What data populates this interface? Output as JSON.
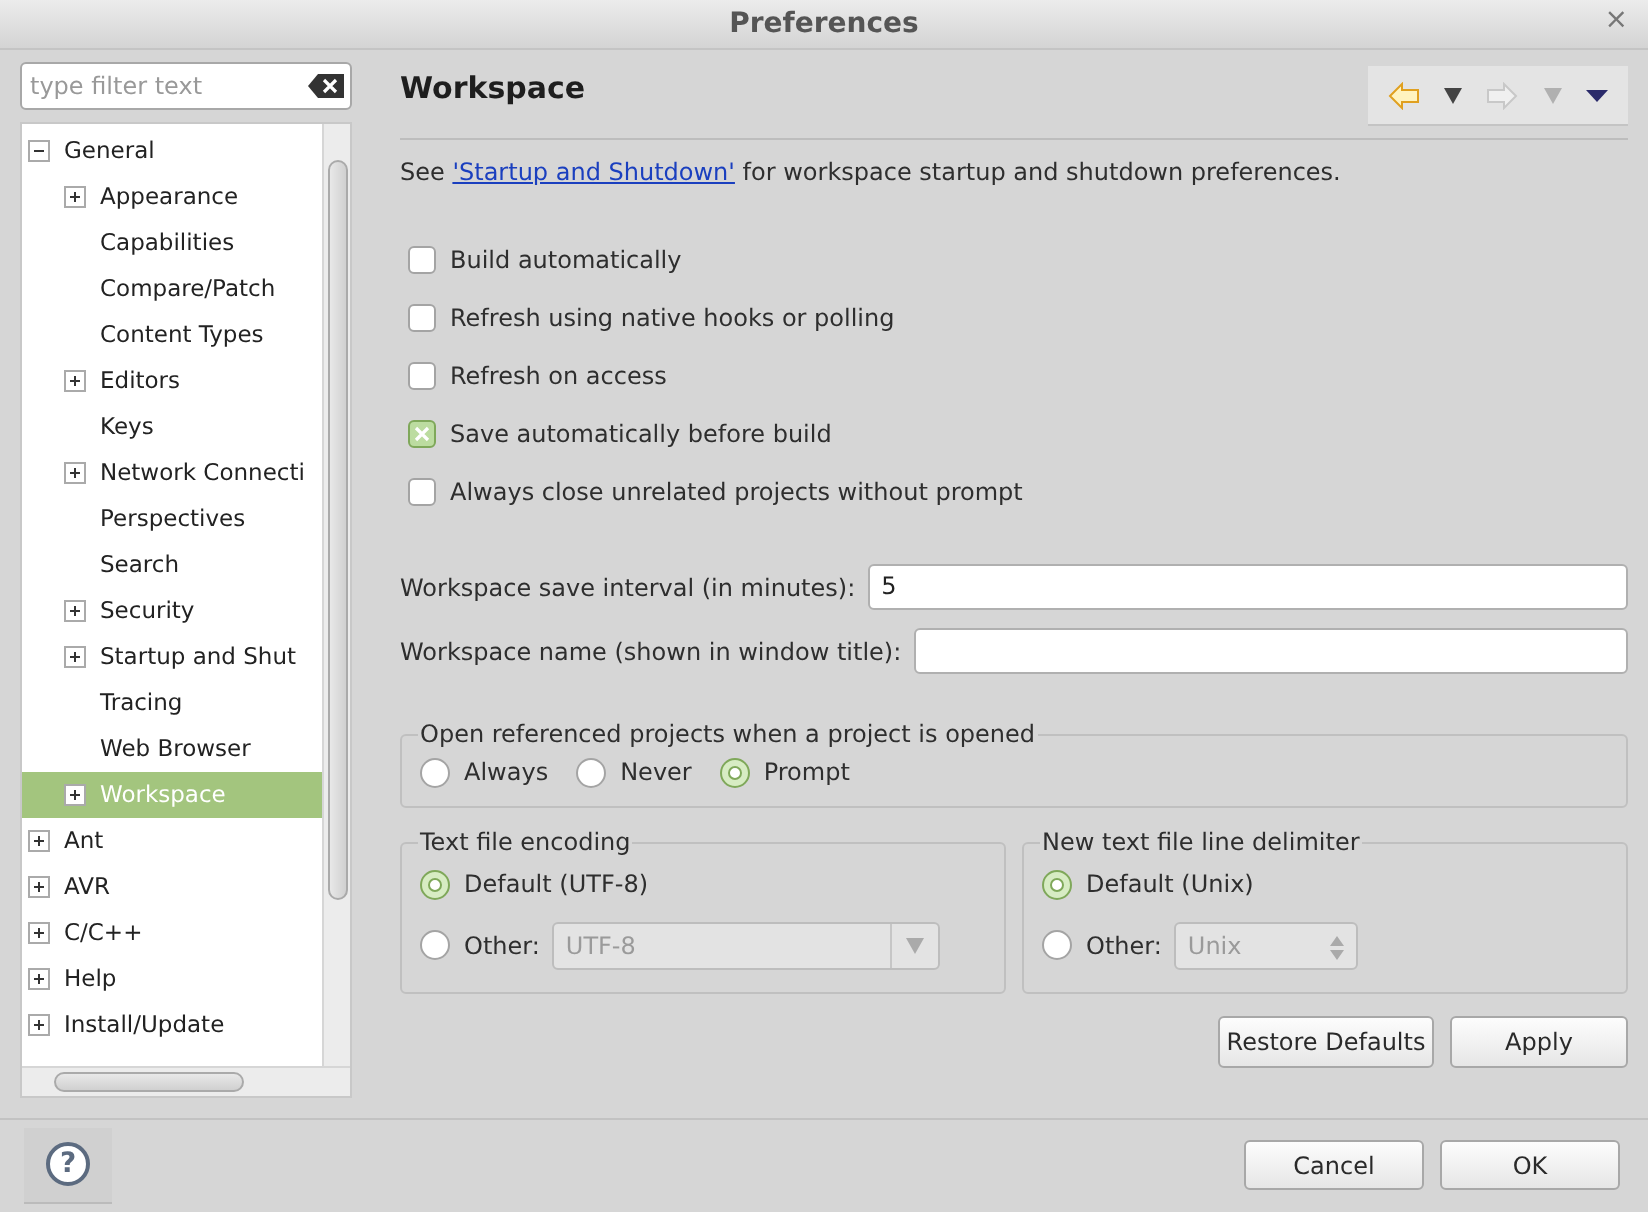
{
  "window": {
    "title": "Preferences",
    "close": "×"
  },
  "filter": {
    "placeholder": "type filter text"
  },
  "tree": [
    {
      "label": "General",
      "expanded": true,
      "selected": false,
      "children": [
        {
          "label": "Appearance",
          "expanded": false,
          "selected": false
        },
        {
          "label": "Capabilities",
          "selected": false
        },
        {
          "label": "Compare/Patch",
          "selected": false
        },
        {
          "label": "Content Types",
          "selected": false
        },
        {
          "label": "Editors",
          "expanded": false,
          "selected": false
        },
        {
          "label": "Keys",
          "selected": false
        },
        {
          "label": "Network Connecti",
          "expanded": false,
          "selected": false
        },
        {
          "label": "Perspectives",
          "selected": false
        },
        {
          "label": "Search",
          "selected": false
        },
        {
          "label": "Security",
          "expanded": false,
          "selected": false
        },
        {
          "label": "Startup and Shut",
          "expanded": false,
          "selected": false
        },
        {
          "label": "Tracing",
          "selected": false
        },
        {
          "label": "Web Browser",
          "selected": false
        },
        {
          "label": "Workspace",
          "expanded": false,
          "selected": true
        }
      ]
    },
    {
      "label": "Ant",
      "expanded": false,
      "selected": false
    },
    {
      "label": "AVR",
      "expanded": false,
      "selected": false
    },
    {
      "label": "C/C++",
      "expanded": false,
      "selected": false
    },
    {
      "label": "Help",
      "expanded": false,
      "selected": false
    },
    {
      "label": "Install/Update",
      "expanded": false,
      "selected": false
    }
  ],
  "page": {
    "title": "Workspace",
    "history": {
      "back_enabled": true,
      "forward_enabled": false
    },
    "intro_before": "See ",
    "link": "'Startup and Shutdown'",
    "intro_after": " for workspace startup and shutdown preferences."
  },
  "checkboxes": [
    {
      "label": "Build automatically",
      "checked": false
    },
    {
      "label": "Refresh using native hooks or polling",
      "checked": false
    },
    {
      "label": "Refresh on access",
      "checked": false
    },
    {
      "label": "Save automatically before build",
      "checked": true
    },
    {
      "label": "Always close unrelated projects without prompt",
      "checked": false
    }
  ],
  "fields": [
    {
      "label": "Workspace save interval (in minutes):",
      "value": "5"
    },
    {
      "label": "Workspace name (shown in window title):"
    }
  ],
  "open_referenced": {
    "title": "Open referenced projects when a project is opened",
    "options": [
      {
        "label": "Always",
        "selected": false
      },
      {
        "label": "Never",
        "selected": false
      },
      {
        "label": "Prompt",
        "selected": true
      }
    ]
  },
  "encoding_groups": [
    {
      "title": "Text file encoding",
      "options": [
        {
          "kind": "plain",
          "label": "Default (UTF-8)",
          "selected": true
        },
        {
          "kind": "combo",
          "label": "Other:",
          "selected": false,
          "value": "UTF-8",
          "disabled": true
        }
      ]
    },
    {
      "title": "New text file line delimiter",
      "options": [
        {
          "kind": "plain",
          "label": "Default (Unix)",
          "selected": true
        },
        {
          "kind": "spinner",
          "label": "Other:",
          "selected": false,
          "value": "Unix",
          "disabled": true
        }
      ]
    }
  ],
  "page_buttons": [
    "Restore Defaults",
    "Apply"
  ],
  "help": {
    "label": "?"
  },
  "dialog_buttons": [
    "Cancel",
    "OK"
  ]
}
